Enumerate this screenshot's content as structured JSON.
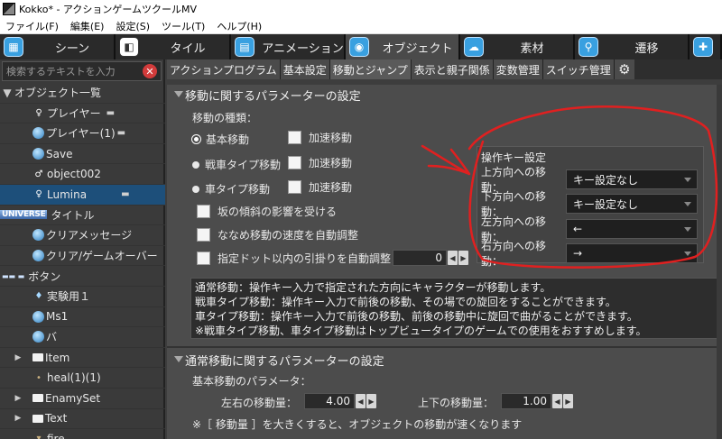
{
  "window": {
    "title": "Kokko* - アクションゲームツクールMV"
  },
  "menu": [
    "ファイル(F)",
    "編集(E)",
    "設定(S)",
    "ツール(T)",
    "ヘルプ(H)"
  ],
  "main_tabs": [
    {
      "label": "シーン",
      "icon": "scene-icon"
    },
    {
      "label": "タイル",
      "icon": "tile-icon"
    },
    {
      "label": "アニメーション",
      "icon": "animation-icon"
    },
    {
      "label": "オブジェクト",
      "icon": "object-icon"
    },
    {
      "label": "素材",
      "icon": "material-icon"
    },
    {
      "label": "遷移",
      "icon": "transition-icon"
    }
  ],
  "search": {
    "placeholder": "検索するテキストを入力"
  },
  "tree": [
    {
      "label": "オブジェクト一覧",
      "icon": "toggle",
      "level": 0
    },
    {
      "label": "プレイヤー",
      "icon": "char",
      "pad": true
    },
    {
      "label": "プレイヤー(1)",
      "icon": "ball",
      "pad": true
    },
    {
      "label": "Save",
      "icon": "ball"
    },
    {
      "label": "object002",
      "icon": "char"
    },
    {
      "label": "Lumina",
      "icon": "char",
      "pad": true,
      "selected": true
    },
    {
      "label": "タイトル",
      "icon": "banner",
      "banner": "UNIVERSE"
    },
    {
      "label": "クリアメッセージ",
      "icon": "ball"
    },
    {
      "label": "クリア/ゲームオーバー",
      "icon": "ball"
    },
    {
      "label": "ボタン",
      "icon": "banner2"
    },
    {
      "label": "実験用１",
      "icon": "flask"
    },
    {
      "label": "Ms1",
      "icon": "ball"
    },
    {
      "label": "バ",
      "icon": "ball"
    },
    {
      "label": "Item",
      "icon": "folder",
      "collapsed": true
    },
    {
      "label": "heal(1)(1)",
      "icon": "dot"
    },
    {
      "label": "EnamySet",
      "icon": "folder",
      "collapsed": true
    },
    {
      "label": "Text",
      "icon": "folder",
      "collapsed": true
    },
    {
      "label": "fire",
      "icon": "dot"
    }
  ],
  "sub_tabs": [
    "アクションプログラム",
    "基本設定",
    "移動とジャンプ",
    "表示と親子関係",
    "変数管理",
    "スイッチ管理"
  ],
  "move_section": {
    "title": "移動に関するパラメーターの設定",
    "type_label": "移動の種類：",
    "radios": [
      "基本移動",
      "戦車タイプ移動",
      "車タイプ移動"
    ],
    "accel_label": "加速移動",
    "slope_label": "坂の傾斜の影響を受ける",
    "diag_label": "ななめ移動の速度を自動調整",
    "dot_label": "指定ドット以内の引掛りを自動調整",
    "dot_value": "0"
  },
  "key_settings": {
    "title": "操作キー設定",
    "rows": [
      {
        "label": "上方向への移動：",
        "value": "キー設定なし"
      },
      {
        "label": "下方向への移動：",
        "value": "キー設定なし"
      },
      {
        "label": "左方向への移動：",
        "value": "←"
      },
      {
        "label": "右方向への移動：",
        "value": "→"
      }
    ]
  },
  "info_lines": [
    "通常移動：操作キー入力で指定された方向にキャラクターが移動します。",
    "戦車タイプ移動：操作キー入力で前後の移動、その場での旋回をすることができます。",
    "車タイプ移動：操作キー入力で前後の移動、前後の移動中に旋回で曲がることができます。",
    "※戦車タイプ移動、車タイプ移動はトップビュータイプのゲームでの使用をおすすめします。"
  ],
  "normal_section": {
    "title": "通常移動に関するパラメーターの設定",
    "param_label": "基本移動のパラメータ：",
    "lr_label": "左右の移動量：",
    "lr_value": "4.00",
    "ud_label": "上下の移動量：",
    "ud_value": "1.00",
    "note": "※［ 移動量 ］を大きくすると、オブジェクトの移動が速くなります"
  },
  "colors": {
    "annotation": "#e02020",
    "selected_row": "#1d4f7a",
    "tab_icon": "#39a0e0"
  }
}
